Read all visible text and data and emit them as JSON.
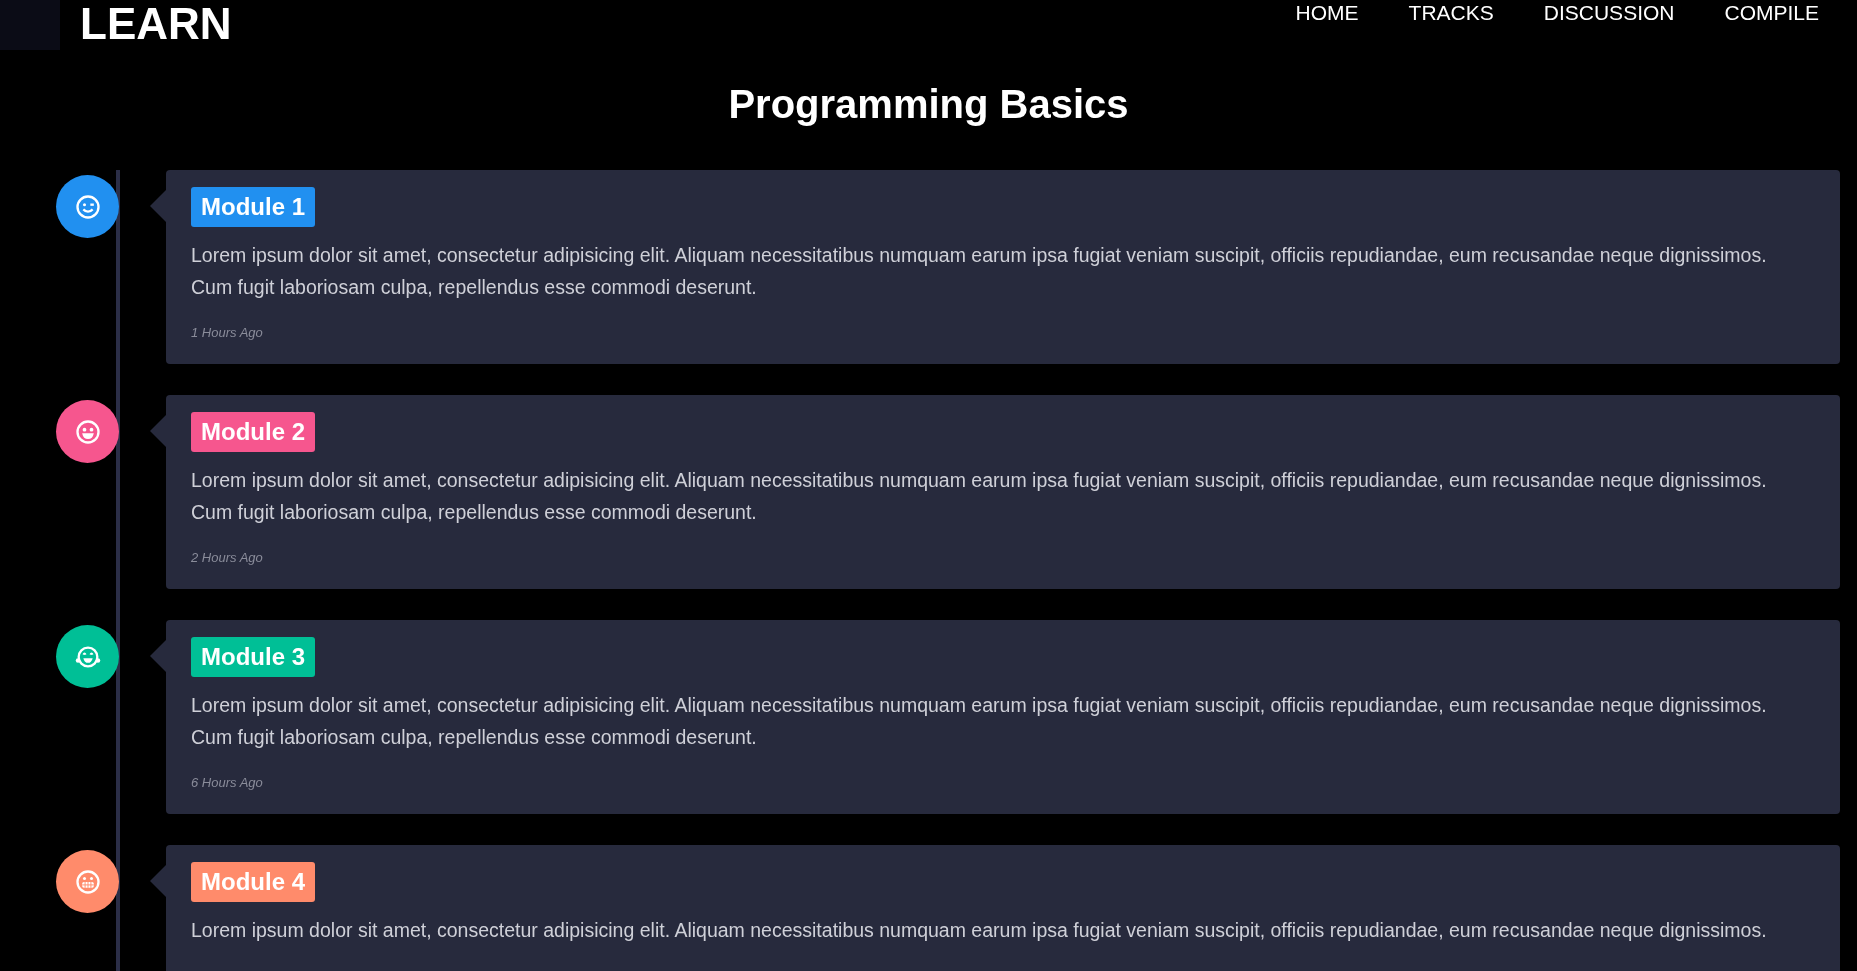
{
  "navbar": {
    "brand": "LEARN",
    "links": [
      {
        "label": "HOME"
      },
      {
        "label": "TRACKS"
      },
      {
        "label": "DISCUSSION"
      },
      {
        "label": "COMPILE"
      }
    ]
  },
  "title": "Programming Basics",
  "modules": [
    {
      "label": "Module 1",
      "color": "#2190f0",
      "description": "Lorem ipsum dolor sit amet, consectetur adipisicing elit. Aliquam necessitatibus numquam earum ipsa fugiat veniam suscipit, officiis repudiandae, eum recusandae neque dignissimos. Cum fugit laboriosam culpa, repellendus esse commodi deserunt.",
      "time": "1 Hours Ago"
    },
    {
      "label": "Module 2",
      "color": "#f6568e",
      "description": "Lorem ipsum dolor sit amet, consectetur adipisicing elit. Aliquam necessitatibus numquam earum ipsa fugiat veniam suscipit, officiis repudiandae, eum recusandae neque dignissimos. Cum fugit laboriosam culpa, repellendus esse commodi deserunt.",
      "time": "2 Hours Ago"
    },
    {
      "label": "Module 3",
      "color": "#00bf96",
      "description": "Lorem ipsum dolor sit amet, consectetur adipisicing elit. Aliquam necessitatibus numquam earum ipsa fugiat veniam suscipit, officiis repudiandae, eum recusandae neque dignissimos. Cum fugit laboriosam culpa, repellendus esse commodi deserunt.",
      "time": "6 Hours Ago"
    },
    {
      "label": "Module 4",
      "color": "#ff8b6b",
      "description": "Lorem ipsum dolor sit amet, consectetur adipisicing elit. Aliquam necessitatibus numquam earum ipsa fugiat veniam suscipit, officiis repudiandae, eum recusandae neque dignissimos."
    }
  ]
}
